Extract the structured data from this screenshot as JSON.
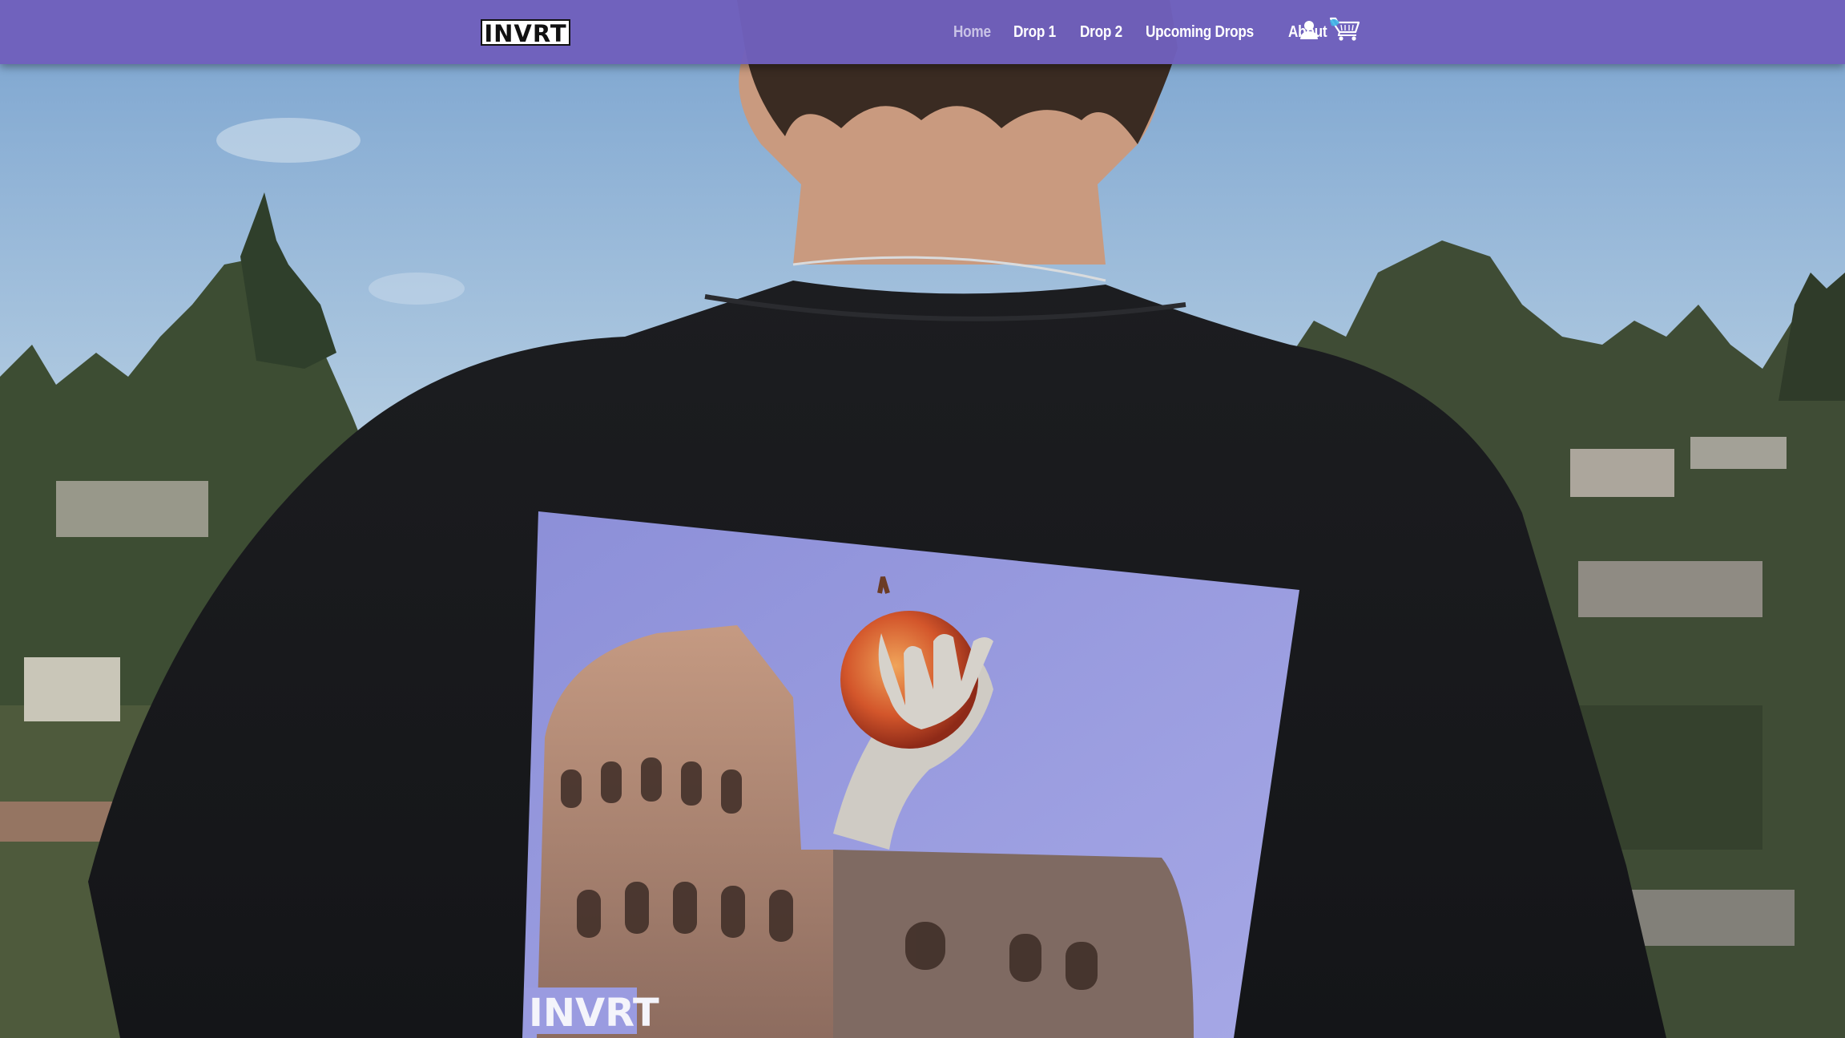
{
  "brand": {
    "logo_text": "INVRT"
  },
  "nav": {
    "items": [
      {
        "label": "Home",
        "active": true
      },
      {
        "label": "Drop 1",
        "active": false
      },
      {
        "label": "Drop 2",
        "active": false
      },
      {
        "label": "Upcoming Drops",
        "active": false
      },
      {
        "label": "About",
        "active": false
      }
    ],
    "account_icon": "user-icon",
    "cart_icon": "shopping-cart-icon"
  },
  "hero": {
    "shirt_print_logo": "INVRT"
  },
  "colors": {
    "navbar": "#7060bc",
    "nav_text": "#ffffff",
    "nav_active_text": "#c9c3e6",
    "cart_accent": "#3fb6e8"
  }
}
